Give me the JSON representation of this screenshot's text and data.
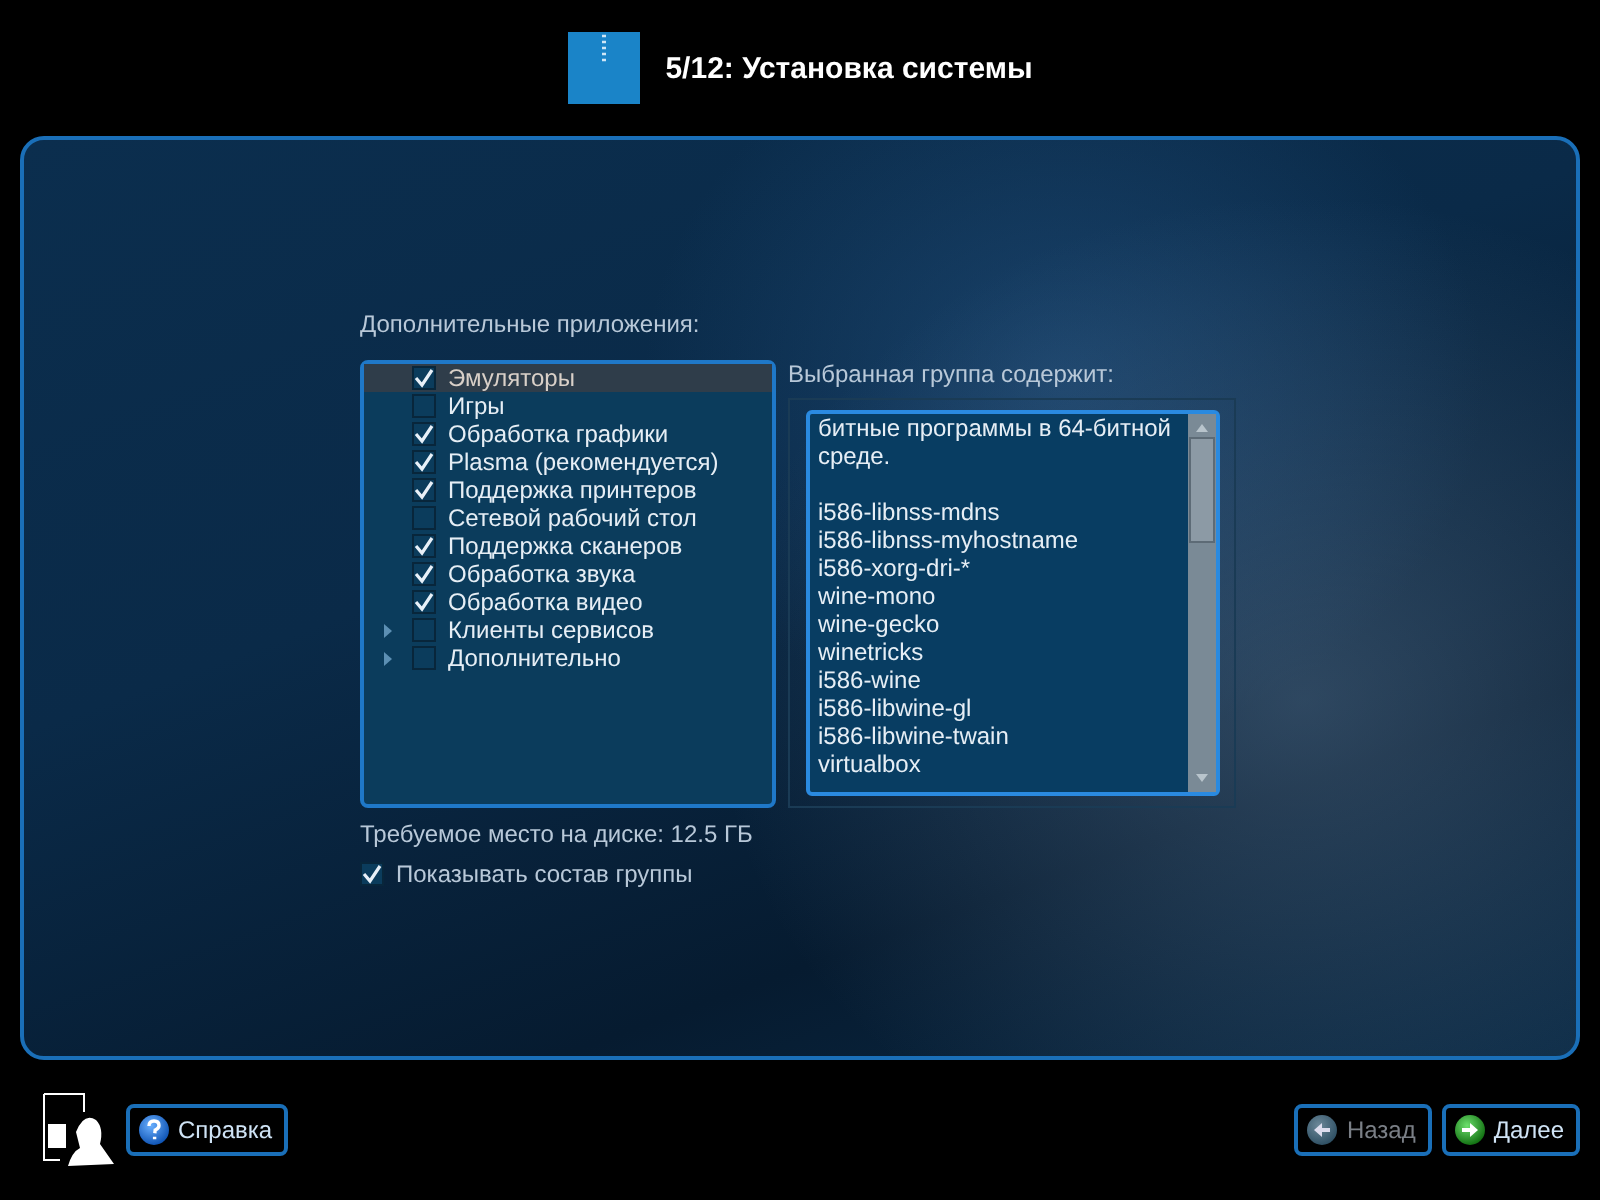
{
  "header": {
    "title": "5/12: Установка системы"
  },
  "apps": {
    "label": "Дополнительные приложения:",
    "items": [
      {
        "label": "Эмуляторы",
        "kind": "leaf",
        "checked": true,
        "selected": true
      },
      {
        "label": "Игры",
        "kind": "leaf",
        "checked": false,
        "selected": false
      },
      {
        "label": "Обработка графики",
        "kind": "leaf",
        "checked": true,
        "selected": false
      },
      {
        "label": "Plasma (рекомендуется)",
        "kind": "leaf",
        "checked": true,
        "selected": false
      },
      {
        "label": "Поддержка принтеров",
        "kind": "leaf",
        "checked": true,
        "selected": false
      },
      {
        "label": "Сетевой рабочий стол",
        "kind": "leaf",
        "checked": false,
        "selected": false
      },
      {
        "label": "Поддержка сканеров",
        "kind": "leaf",
        "checked": true,
        "selected": false
      },
      {
        "label": "Обработка звука",
        "kind": "leaf",
        "checked": true,
        "selected": false
      },
      {
        "label": "Обработка видео",
        "kind": "leaf",
        "checked": true,
        "selected": false
      },
      {
        "label": "Клиенты сервисов",
        "kind": "group",
        "expanded": false,
        "checked": false,
        "selected": false
      },
      {
        "label": "Дополнительно",
        "kind": "group",
        "expanded": false,
        "checked": false,
        "selected": false
      }
    ]
  },
  "group_contents": {
    "label": "Выбранная группа содержит:",
    "description_lines": [
      "битные программы в 64-битной",
      "среде."
    ],
    "packages": [
      "i586-libnss-mdns",
      "i586-libnss-myhostname",
      "i586-xorg-dri-*",
      "wine-mono",
      "wine-gecko",
      "winetricks",
      "i586-wine",
      "i586-libwine-gl",
      "i586-libwine-twain",
      "virtualbox"
    ]
  },
  "disk_space": "Требуемое место на диске: 12.5 ГБ",
  "show_group": {
    "label": "Показывать состав группы",
    "checked": true
  },
  "footer": {
    "help": {
      "label": "Справка"
    },
    "back": {
      "label": "Назад",
      "disabled": true
    },
    "next": {
      "label": "Далее",
      "disabled": false
    }
  }
}
